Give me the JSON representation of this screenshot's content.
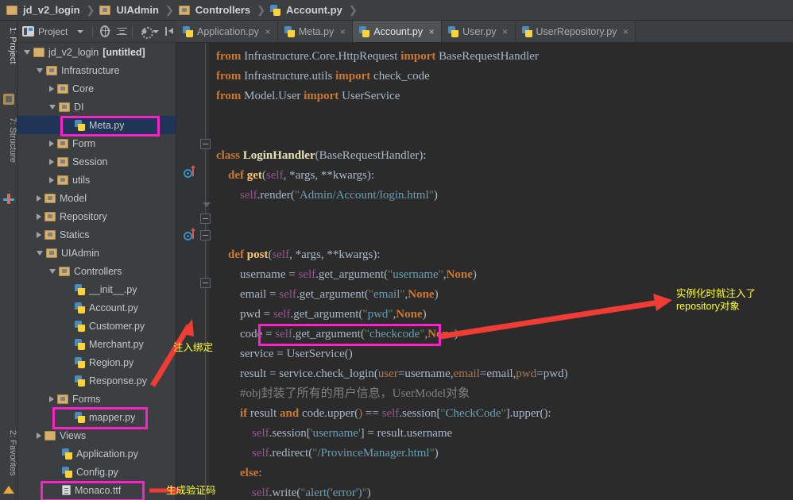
{
  "breadcrumb": {
    "items": [
      {
        "label": "jd_v2_login",
        "icon": "folder-icon"
      },
      {
        "label": "UIAdmin",
        "icon": "folder-package-icon"
      },
      {
        "label": "Controllers",
        "icon": "folder-package-icon"
      },
      {
        "label": "Account.py",
        "icon": "python-file-icon"
      }
    ]
  },
  "left_strip": {
    "tabs": [
      {
        "label": "1: Project",
        "icon": "project-icon"
      },
      {
        "label": "7: Structure",
        "icon": "structure-icon"
      },
      {
        "label": "2: Favorites",
        "icon": "star-icon"
      }
    ]
  },
  "project_toolbar": {
    "title": "Project",
    "icons": [
      "locate-icon",
      "collapse-all-icon",
      "settings-gear-icon",
      "hide-panel-icon"
    ]
  },
  "editor_tabs": [
    {
      "label": "Application.py",
      "active": false,
      "close": "×"
    },
    {
      "label": "Meta.py",
      "active": false,
      "close": "×"
    },
    {
      "label": "Account.py",
      "active": true,
      "close": "×"
    },
    {
      "label": "User.py",
      "active": false,
      "close": "×"
    },
    {
      "label": "UserRepository.py",
      "active": false,
      "close": "×"
    }
  ],
  "tree": [
    {
      "label": "jd_v2_login",
      "suffix": "[untitled]",
      "depth": 0,
      "twisty": "down",
      "icon": "folder-icon",
      "selected": false
    },
    {
      "label": "Infrastructure",
      "depth": 1,
      "twisty": "down",
      "icon": "folder-package-icon",
      "selected": false
    },
    {
      "label": "Core",
      "depth": 2,
      "twisty": "right",
      "icon": "folder-package-icon",
      "selected": false
    },
    {
      "label": "DI",
      "depth": 2,
      "twisty": "down",
      "icon": "folder-package-icon",
      "selected": false
    },
    {
      "label": "Meta.py",
      "depth": 3,
      "twisty": "none",
      "icon": "python-file-icon",
      "selected": true
    },
    {
      "label": "Form",
      "depth": 2,
      "twisty": "right",
      "icon": "folder-package-icon",
      "selected": false
    },
    {
      "label": "Session",
      "depth": 2,
      "twisty": "right",
      "icon": "folder-package-icon",
      "selected": false
    },
    {
      "label": "utils",
      "depth": 2,
      "twisty": "right",
      "icon": "folder-package-icon",
      "selected": false
    },
    {
      "label": "Model",
      "depth": 1,
      "twisty": "right",
      "icon": "folder-package-icon",
      "selected": false
    },
    {
      "label": "Repository",
      "depth": 1,
      "twisty": "right",
      "icon": "folder-package-icon",
      "selected": false
    },
    {
      "label": "Statics",
      "depth": 1,
      "twisty": "right",
      "icon": "folder-package-icon",
      "selected": false
    },
    {
      "label": "UIAdmin",
      "depth": 1,
      "twisty": "down",
      "icon": "folder-package-icon",
      "selected": false
    },
    {
      "label": "Controllers",
      "depth": 2,
      "twisty": "down",
      "icon": "folder-package-icon",
      "selected": false
    },
    {
      "label": "__init__.py",
      "depth": 3,
      "twisty": "none",
      "icon": "python-file-icon",
      "selected": false
    },
    {
      "label": "Account.py",
      "depth": 3,
      "twisty": "none",
      "icon": "python-file-icon",
      "selected": false
    },
    {
      "label": "Customer.py",
      "depth": 3,
      "twisty": "none",
      "icon": "python-file-icon",
      "selected": false
    },
    {
      "label": "Merchant.py",
      "depth": 3,
      "twisty": "none",
      "icon": "python-file-icon",
      "selected": false
    },
    {
      "label": "Region.py",
      "depth": 3,
      "twisty": "none",
      "icon": "python-file-icon",
      "selected": false
    },
    {
      "label": "Response.py",
      "depth": 3,
      "twisty": "none",
      "icon": "python-file-icon",
      "selected": false
    },
    {
      "label": "Forms",
      "depth": 2,
      "twisty": "right",
      "icon": "folder-package-icon",
      "selected": false
    },
    {
      "label": "mapper.py",
      "depth": 3,
      "twisty": "none",
      "icon": "python-file-icon",
      "selected": false
    },
    {
      "label": "Views",
      "depth": 1,
      "twisty": "right",
      "icon": "folder-icon",
      "selected": false
    },
    {
      "label": "Application.py",
      "depth": 2,
      "twisty": "none",
      "icon": "python-file-icon",
      "selected": false
    },
    {
      "label": "Config.py",
      "depth": 2,
      "twisty": "none",
      "icon": "python-file-icon",
      "selected": false
    },
    {
      "label": "Monaco.ttf",
      "depth": 2,
      "twisty": "none",
      "icon": "generic-file-icon",
      "selected": false
    }
  ],
  "code_lines": [
    "from Infrastructure.Core.HttpRequest import BaseRequestHandler",
    "from Infrastructure.utils import check_code",
    "from Model.User import UserService",
    "",
    "",
    "class LoginHandler(BaseRequestHandler):",
    "    def get(self, *args, **kwargs):",
    "        self.render(\"Admin/Account/login.html\")",
    "",
    "",
    "    def post(self, *args, **kwargs):",
    "        username = self.get_argument(\"username\",None)",
    "        email = self.get_argument(\"email\",None)",
    "        pwd = self.get_argument(\"pwd\",None)",
    "        code = self.get_argument(\"checkcode\",None)",
    "        service = UserService()",
    "        result = service.check_login(user=username,email=email,pwd=pwd)",
    "        #obj封装了所有的用户信息，UserModel对象",
    "        if result and code.upper() == self.session[\"CheckCode\"].upper():",
    "            self.session['username'] = result.username",
    "            self.redirect(\"/ProvinceManager.html\")",
    "        else:",
    "            self.write(\"alert('error')\")"
  ],
  "annotations": [
    {
      "id": "anno-inject-bind",
      "text": "注入绑定"
    },
    {
      "id": "anno-repository",
      "text": "实例化时就注入了\nrepository对象"
    },
    {
      "id": "anno-gen-captcha",
      "text": "生成验证码"
    }
  ],
  "colors": {
    "highlight_box": "#ff21c8",
    "arrow": "#f03c34",
    "annotation_text": "#ffff2e",
    "editor_bg": "#2b2b2b",
    "panel_bg": "#3c3f41",
    "selection_bg": "#1f3558"
  }
}
